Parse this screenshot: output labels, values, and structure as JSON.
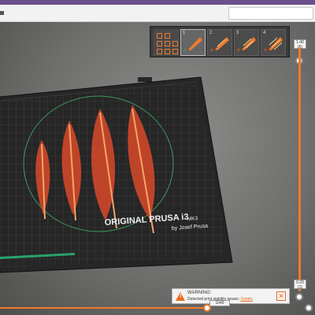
{
  "bed": {
    "brand_line": "ORIGINAL PRUSA i3",
    "model": "MK3",
    "byline": "by Josef Prusa"
  },
  "objects": [
    {
      "num": "1",
      "status": "ok",
      "selected": true
    },
    {
      "num": "2",
      "status": "warning",
      "selected": false
    },
    {
      "num": "3",
      "status": "warning",
      "selected": false
    },
    {
      "num": "4",
      "status": "warning",
      "selected": false
    }
  ],
  "vertical_slider": {
    "top_value": "1.40",
    "top_sub": "(5)",
    "bottom_value": "0.20",
    "bottom_sub": "(1)"
  },
  "horizontal_slider": {
    "value": "1049",
    "position": 0.66
  },
  "warning": {
    "icon": "warning-triangle-icon",
    "title": "WARNING:",
    "message": "Detected print stability issues:",
    "link": "Details",
    "close_icon": "close-icon"
  },
  "colors": {
    "accent": "#f07a2a",
    "model": "#e2572c",
    "toolpath": "#f4a35d"
  }
}
